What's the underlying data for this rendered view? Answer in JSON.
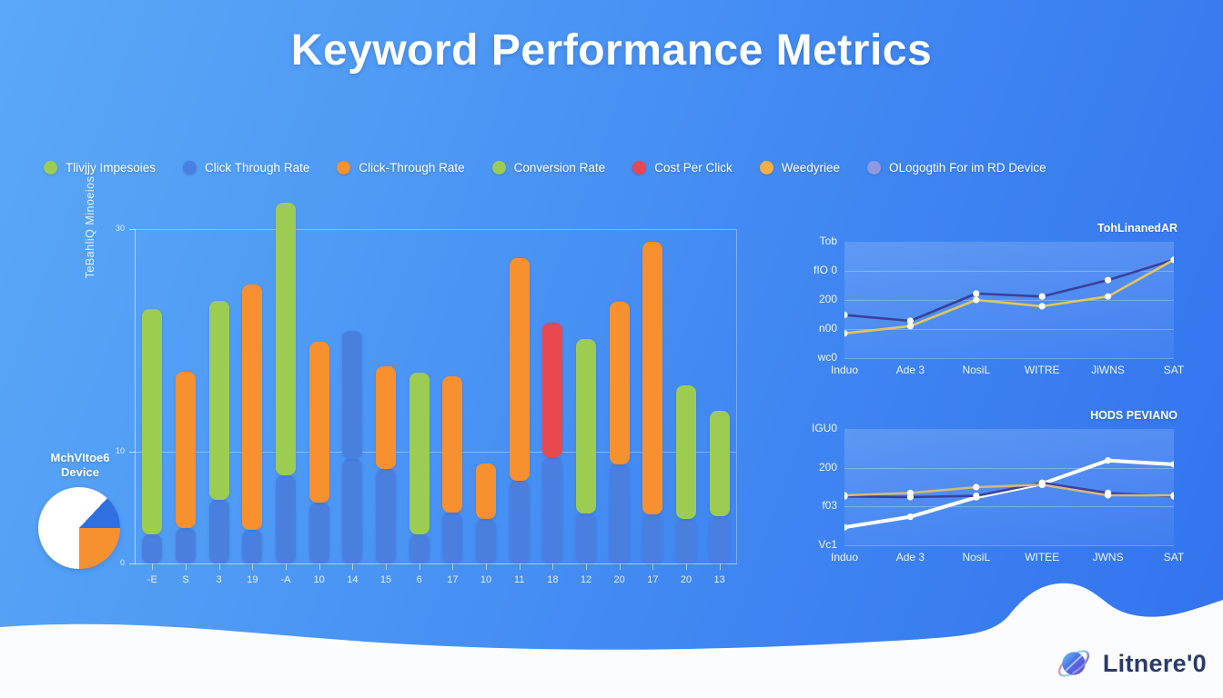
{
  "header": {
    "title": "Keyword Performance Metrics"
  },
  "legend": {
    "items": [
      {
        "label": "Tlivjjy Impesoies",
        "color": "#9ccc52"
      },
      {
        "label": "Click Through Rate",
        "color": "#4a7fe0"
      },
      {
        "label": "Click-Through Rate",
        "color": "#f7902e"
      },
      {
        "label": "Conversion Rate",
        "color": "#9ccc52"
      },
      {
        "label": "Cost Per Click",
        "color": "#e8484f"
      },
      {
        "label": "Weedyriee",
        "color": "#f5ad47"
      },
      {
        "label": "OLogogtih For im RD Device",
        "color": "#8d9ae0"
      }
    ]
  },
  "pie": {
    "label_line1": "MchVItoe6",
    "label_line2": "Device",
    "slices": [
      {
        "name": "white-slice",
        "value": 62,
        "color": "#ffffff"
      },
      {
        "name": "blue-slice",
        "value": 13,
        "color": "#2f6fe0"
      },
      {
        "name": "orange-slice",
        "value": 25,
        "color": "#f7902e"
      }
    ]
  },
  "chart_data": [
    {
      "id": "main-bar-chart",
      "type": "bar",
      "title": "",
      "ylabel": "TeBahliQ Minoeios",
      "xlabel": "",
      "ylim": [
        0,
        30
      ],
      "grid": true,
      "ytick_labels": [
        "0",
        "10",
        "30"
      ],
      "ytick_values": [
        0,
        10,
        30
      ],
      "categories": [
        "-E",
        "S",
        "3",
        "19",
        "-A",
        "10",
        "14",
        "15",
        "6",
        "17",
        "10",
        "11",
        "18",
        "12",
        "20",
        "17",
        "20",
        "13"
      ],
      "stacked": true,
      "series": [
        {
          "name": "Click Through Rate",
          "color": "#4a7fe0",
          "values": [
            2.6,
            3.2,
            5.7,
            3.0,
            7.9,
            5.5,
            9.4,
            8.5,
            2.6,
            4.6,
            4.0,
            7.4,
            9.5,
            4.5,
            8.9,
            4.4,
            4.0,
            4.2
          ]
        },
        {
          "name": "Conversion Rate / Click-Through Rate / Cost Per Click",
          "color": "#9ccc52",
          "values": [
            20.2,
            14.0,
            17.9,
            22.0,
            24.5,
            14.4,
            11.5,
            9.2,
            14.5,
            12.2,
            5.0,
            20.0,
            12.1,
            15.6,
            14.6,
            24.5,
            12.0,
            9.5
          ]
        }
      ],
      "bar_segment_colors": [
        "#9ccc52",
        "#f7902e",
        "#9ccc52",
        "#f7902e",
        "#9ccc52",
        "#f7902e",
        "#4a7fe0",
        "#f7902e",
        "#9ccc52",
        "#f7902e",
        "#f7902e",
        "#f7902e",
        "#e8484f",
        "#9ccc52",
        "#f7902e",
        "#f7902e",
        "#9ccc52",
        "#9ccc52"
      ]
    },
    {
      "id": "line-chart-top",
      "type": "line",
      "title": "TohLinanedAR",
      "ytick_labels": [
        "Tob",
        "fIO 0",
        "200",
        "n00",
        "wc0"
      ],
      "x": [
        "Induo",
        "Ade 3",
        "NosiL",
        "WITRE",
        "JiWNS",
        "SAT"
      ],
      "ylim": [
        0,
        400
      ],
      "series": [
        {
          "name": "navy-line",
          "color": "#3b3f9e",
          "values": [
            148,
            128,
            222,
            212,
            268,
            338
          ]
        },
        {
          "name": "gold-line",
          "color": "#e2c75a",
          "values": [
            85,
            110,
            200,
            178,
            212,
            338
          ]
        }
      ]
    },
    {
      "id": "line-chart-bottom",
      "type": "line",
      "title": "HODS PEVIANO",
      "ytick_labels": [
        "IGU0",
        "200",
        "f03",
        "Vc1"
      ],
      "x": [
        "Induo",
        "Ade 3",
        "NosiL",
        "WITEE",
        "JWNS",
        "SAT"
      ],
      "ylim": [
        0,
        400
      ],
      "series": [
        {
          "name": "white-line",
          "color": "#ffffff",
          "values": [
            62,
            98,
            165,
            212,
            292,
            278
          ]
        },
        {
          "name": "navy-line",
          "color": "#3b3f9e",
          "values": [
            168,
            166,
            170,
            215,
            180,
            168
          ]
        },
        {
          "name": "gold-line",
          "color": "#d4b97f",
          "values": [
            172,
            180,
            200,
            208,
            172,
            172
          ]
        }
      ]
    }
  ],
  "footer": {
    "brand": "Litnere'0"
  }
}
